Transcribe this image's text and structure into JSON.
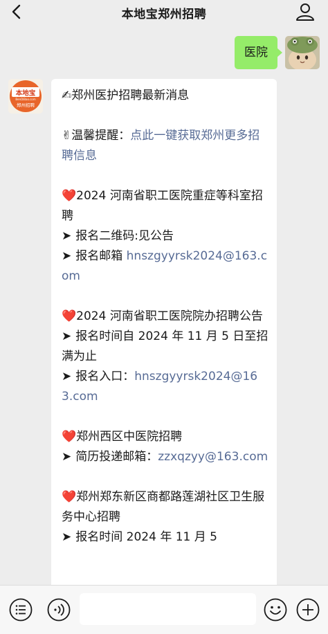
{
  "header": {
    "title": "本地宝郑州招聘"
  },
  "outgoing": {
    "text": "医院"
  },
  "bot_avatar": {
    "logo_text": "本地宝",
    "logo_sub": "BenDiBao.com",
    "caption": "郑州招聘"
  },
  "message": {
    "title_prefix": "✍",
    "title": "郑州医护招聘最新消息",
    "tip_prefix": "✌",
    "tip_label": "温馨提醒：",
    "tip_link": "点此一键获取郑州更多招聘信息",
    "sections": [
      {
        "heading": "2024 河南省职工医院重症等科室招聘",
        "items": [
          {
            "label": "报名二维码:",
            "value": "见公告",
            "is_link": false
          },
          {
            "label": "报名邮箱 ",
            "value": "hnszgyyrsk2024@163.com",
            "is_link": true
          }
        ]
      },
      {
        "heading": "2024 河南省职工医院院办招聘公告",
        "items": [
          {
            "label": "报名时间自 2024 年 11 月 5 日至招满为止",
            "value": "",
            "is_link": false
          },
          {
            "label": "报名入口：",
            "value": "hnszgyyrsk2024@163.com",
            "is_link": true
          }
        ]
      },
      {
        "heading": "郑州西区中医院招聘",
        "items": [
          {
            "label": "简历投递邮箱：",
            "value": "zzxqzyy@163.com",
            "is_link": true
          }
        ]
      },
      {
        "heading": "郑州郑东新区商都路莲湖社区卫生服务中心招聘",
        "items": [
          {
            "label": "报名时间 2024 年 11 月 5",
            "value": "",
            "is_link": false
          }
        ]
      }
    ]
  },
  "icons": {
    "back": "chevron-left-icon",
    "profile": "person-icon",
    "menu": "menu-list-icon",
    "voice": "voice-icon",
    "emoji": "emoji-icon",
    "plus": "plus-icon"
  },
  "colors": {
    "bubble_out": "#95ec69",
    "link": "#576b95",
    "heart": "#e02b2b",
    "logo": "#e8652a"
  }
}
